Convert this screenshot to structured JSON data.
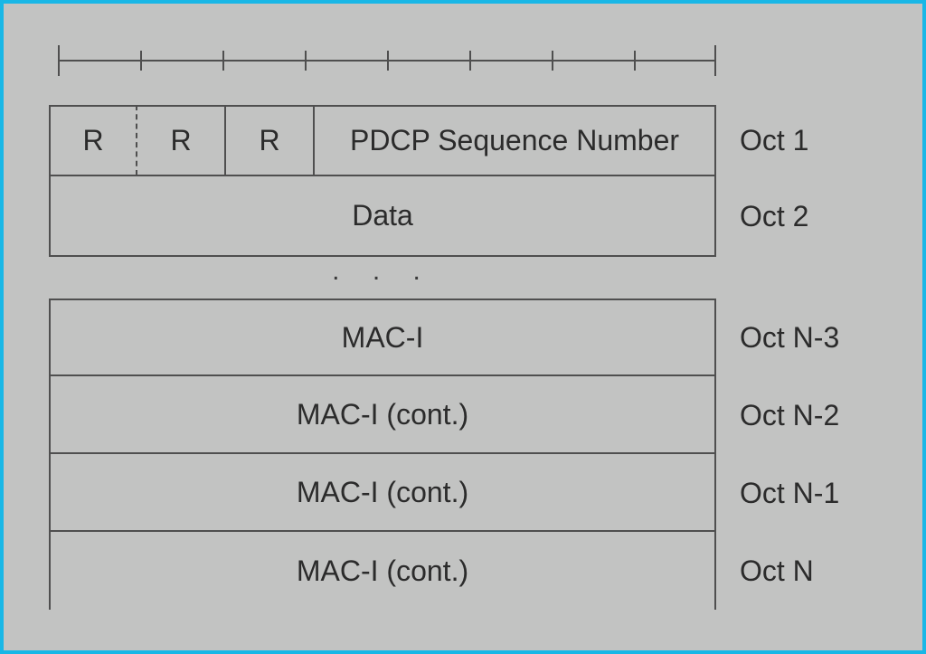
{
  "header": {
    "r_bits": [
      "R",
      "R",
      "R"
    ],
    "seq_label": "PDCP Sequence Number",
    "oct_label": "Oct 1"
  },
  "data_row": {
    "label": "Data",
    "oct_label": "Oct 2"
  },
  "ellipsis": ". . .",
  "mac_rows": [
    {
      "label": "MAC-I",
      "oct_label": "Oct N-3"
    },
    {
      "label": "MAC-I (cont.)",
      "oct_label": "Oct N-2"
    },
    {
      "label": "MAC-I (cont.)",
      "oct_label": "Oct N-1"
    },
    {
      "label": "MAC-I (cont.)",
      "oct_label": "Oct N"
    }
  ]
}
